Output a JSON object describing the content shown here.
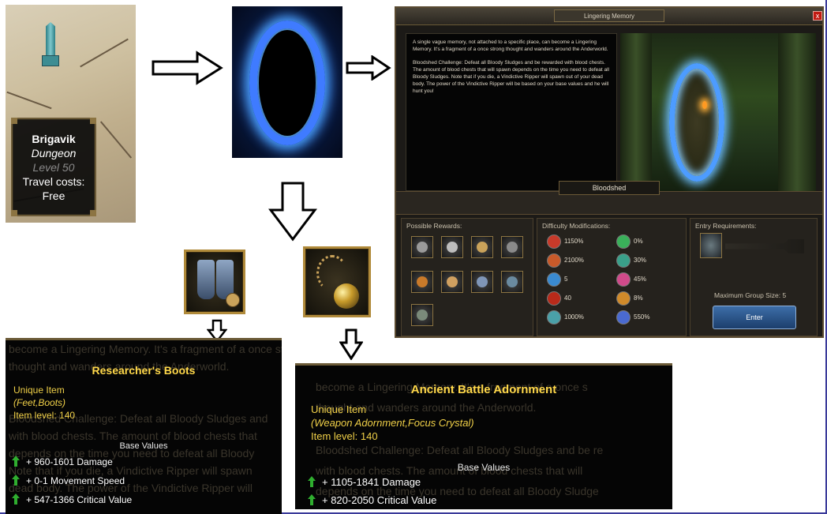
{
  "map": {
    "location_name": "Brigavik",
    "location_type": "Dungeon",
    "level": "Level 50",
    "travel_label": "Travel costs:",
    "travel_cost": "Free"
  },
  "window": {
    "title": "Lingering Memory",
    "close_glyph": "x",
    "description": [
      "A single vague memory, not attached to a specific place, can become a Lingering Memory. It's a fragment of a once strong thought and wanders around the Anderworld.",
      "Bloodshed Challenge: Defeat all Bloody Sludges and be rewarded with blood chests. The amount of blood chests that will spawn depends on the time you need to defeat all Bloody Sludges. Note that if you die, a Vindictive Ripper will spawn out of your dead body. The power of the Vindictive Ripper will be based on your base values and he will hunt you!"
    ],
    "mode_label": "Bloodshed",
    "rewards_title": "Possible Rewards:",
    "difficulty_title": "Difficulty Modifications:",
    "difficulty_values": [
      "1150%",
      "0%",
      "2100%",
      "30%",
      "5",
      "45%",
      "40",
      "8%",
      "1000%",
      "550%"
    ],
    "entry_title": "Entry Requirements:",
    "group_size": "Maximum Group Size: 5",
    "enter_label": "Enter"
  },
  "item1": {
    "name": "Researcher's Boots",
    "kind": "Unique Item",
    "type": "(Feet,Boots)",
    "level": "Item level: 140",
    "base_title": "Base Values",
    "stats": [
      "+ 960-1601 Damage",
      "+ 0-1 Movement Speed",
      "+ 547-1366 Critical Value"
    ],
    "ghost_text": [
      "become a Lingering Memory. It's a fragment of a once strong",
      "thought and wanders around the Anderworld.",
      "",
      "Bloodshed Challenge: Defeat all Bloody Sludges and",
      "with blood chests. The amount of blood chests that",
      "depends on the time you need to defeat all Bloody",
      "Note that if you die, a Vindictive Ripper will spawn",
      "dead body. The power of the Vindictive Ripper will"
    ]
  },
  "item2": {
    "name": "Ancient Battle Adornment",
    "kind": "Unique Item",
    "type": "(Weapon Adornment,Focus Crystal)",
    "level": "Item level: 140",
    "base_title": "Base Values",
    "stats": [
      "+ 1105-1841 Damage",
      "+ 820-2050 Critical Value"
    ],
    "ghost_text": [
      "become a Lingering Memory. It's a fragment of a once s",
      "thought and wanders around the Anderworld.",
      "",
      "Bloodshed Challenge: Defeat all Bloody Sludges and be re",
      "with blood chests. The amount of blood chests that will",
      "depends on the time you need to defeat all Bloody Sludge"
    ]
  },
  "colors": {
    "accent_gold": "#ffd84a",
    "arrow_up_green": "#2fae2f",
    "enter_blue": "#2a5a94",
    "close_red": "#c21a12"
  },
  "icons": [
    "obelisk-icon",
    "portal-icon",
    "boots-icon",
    "flail-icon",
    "arrow-right-icon",
    "arrow-down-icon",
    "stat-up-arrow-icon"
  ]
}
